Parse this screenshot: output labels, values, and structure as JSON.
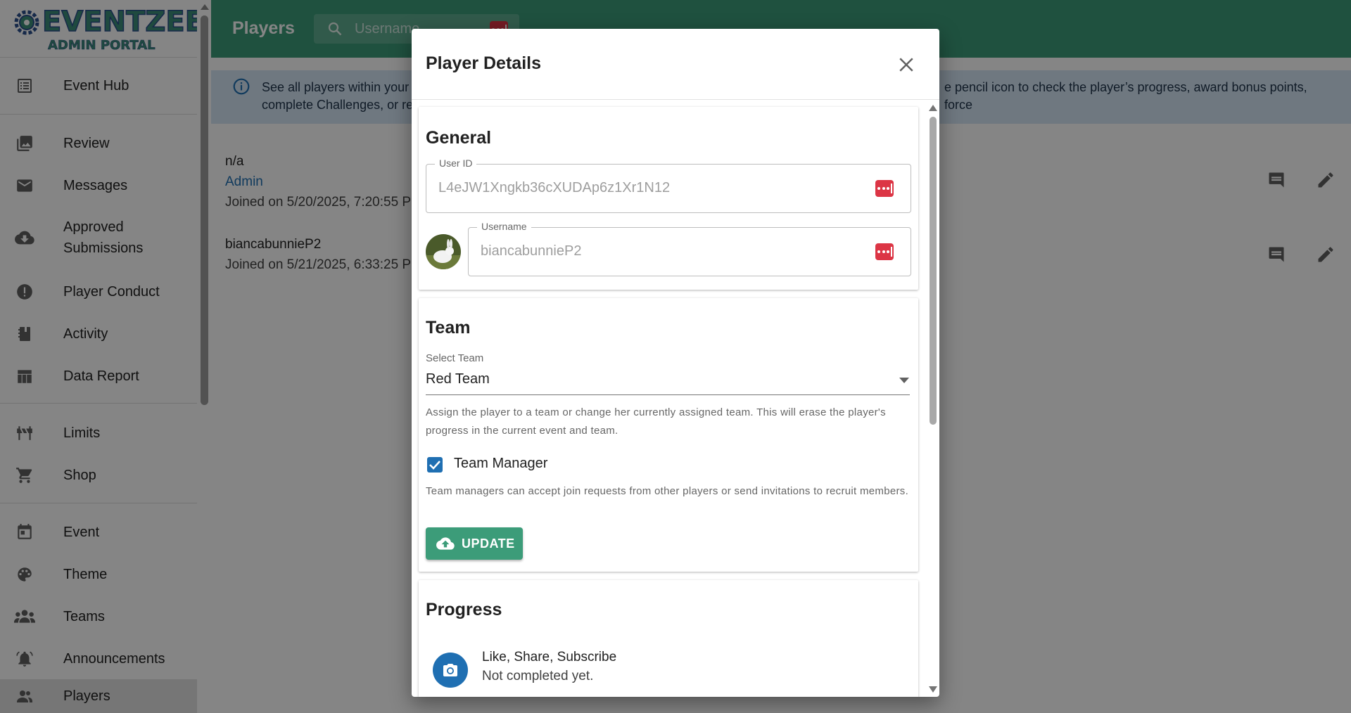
{
  "brand": {
    "name": "EVENTZEE",
    "subtitle": "ADMIN PORTAL"
  },
  "sidebar": {
    "items": [
      {
        "label": "Event Hub",
        "icon": "list-icon"
      },
      {
        "label": "Review",
        "icon": "photo-library-icon"
      },
      {
        "label": "Messages",
        "icon": "mail-icon"
      },
      {
        "label": "Approved Submissions",
        "icon": "cloud-download-icon"
      },
      {
        "label": "Player Conduct",
        "icon": "alert-icon"
      },
      {
        "label": "Activity",
        "icon": "journal-icon"
      },
      {
        "label": "Data Report",
        "icon": "table-icon"
      },
      {
        "label": "Limits",
        "icon": "roadblock-icon"
      },
      {
        "label": "Shop",
        "icon": "cart-icon"
      },
      {
        "label": "Event",
        "icon": "calendar-icon"
      },
      {
        "label": "Theme",
        "icon": "palette-icon"
      },
      {
        "label": "Teams",
        "icon": "groups-icon"
      },
      {
        "label": "Announcements",
        "icon": "bell-icon"
      },
      {
        "label": "Players",
        "icon": "people-icon"
      }
    ],
    "active": "Players"
  },
  "header": {
    "title": "Players",
    "search_placeholder": "Username"
  },
  "info_banner": {
    "text_left": "See all players within your e",
    "text_left2": "complete Challenges, or re",
    "text_right": "e pencil icon to check the player’s progress, award bonus points, force"
  },
  "players": [
    {
      "name": "n/a",
      "role": "Admin",
      "joined": "Joined on 5/20/2025, 7:20:55 PM"
    },
    {
      "name": "biancabunnieP2",
      "role": "",
      "joined": "Joined on 5/21/2025, 6:33:25 PM"
    }
  ],
  "dialog": {
    "title": "Player Details",
    "general": {
      "heading": "General",
      "user_id_label": "User ID",
      "user_id": "L4eJW1Xngkb36cXUDAp6z1Xr1N12",
      "username_label": "Username",
      "username": "biancabunnieP2"
    },
    "team": {
      "heading": "Team",
      "select_label": "Select Team",
      "selected": "Red Team",
      "helper": "Assign the player to a team or change her currently assigned team. This will erase the player's progress in the current event and team.",
      "manager_label": "Team Manager",
      "manager_checked": true,
      "manager_helper": "Team managers can accept join requests from other players or send invitations to recruit members.",
      "update_label": "UPDATE"
    },
    "progress": {
      "heading": "Progress",
      "items": [
        {
          "title": "Like, Share, Subscribe",
          "status": "Not completed yet.",
          "icon": "camera-icon"
        }
      ]
    }
  },
  "colors": {
    "primary": "#3c9c79",
    "accent_blue": "#1f6fb2",
    "danger": "#dc3545",
    "info_bg": "#d5e7f5"
  }
}
